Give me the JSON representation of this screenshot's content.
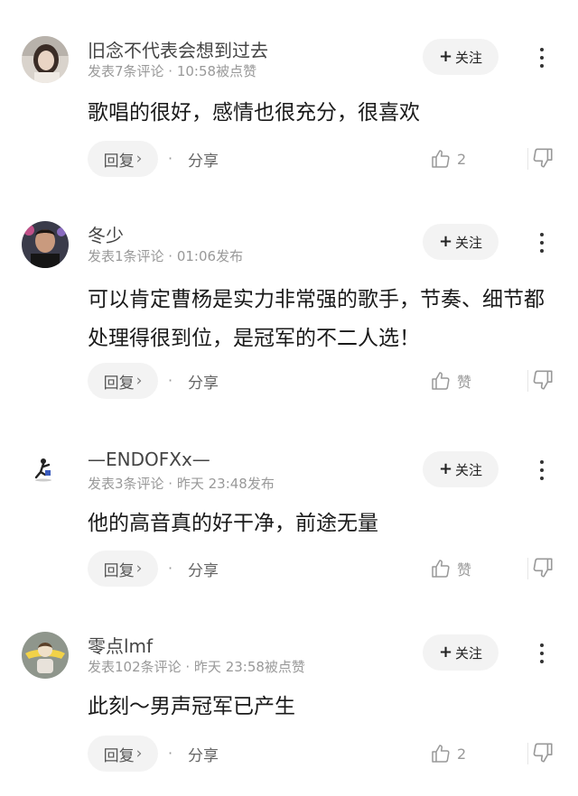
{
  "comments": [
    {
      "username": "旧念不代表会想到过去",
      "meta": "发表7条评论 · 10:58被点赞",
      "content": "歌唱的很好，感情也很充分，很喜欢",
      "follow_label": "关注",
      "reply_label": "回复",
      "share_label": "分享",
      "likes": "2",
      "avatar_icon": "avatar-photo-woman"
    },
    {
      "username": "冬少",
      "meta": "发表1条评论 · 01:06发布",
      "content": "可以肯定曹杨是实力非常强的歌手，节奏、细节都处理得很到位，是冠军的不二人选！",
      "follow_label": "关注",
      "reply_label": "回复",
      "share_label": "分享",
      "likes": "赞",
      "avatar_icon": "avatar-photo-man"
    },
    {
      "username": "—ENDOFXx—",
      "meta": "发表3条评论 · 昨天 23:48发布",
      "content": "他的高音真的好干净，前途无量",
      "follow_label": "关注",
      "reply_label": "回复",
      "share_label": "分享",
      "likes": "赞",
      "avatar_icon": "avatar-photo-figure"
    },
    {
      "username": "零点lmf",
      "meta": "发表102条评论 · 昨天 23:58被点赞",
      "content": "此刻～男声冠军已产生",
      "follow_label": "关注",
      "reply_label": "回复",
      "share_label": "分享",
      "likes": "2",
      "avatar_icon": "avatar-photo-cartoon"
    }
  ],
  "icons": {
    "follow": "plus-icon",
    "more": "more-vertical-icon",
    "reply": "chevron-right-icon",
    "like": "thumbs-up-icon",
    "dislike": "thumbs-down-icon"
  },
  "colors": {
    "text_primary": "#1a1a1a",
    "text_secondary": "#999999",
    "button_bg": "#f3f3f3"
  }
}
